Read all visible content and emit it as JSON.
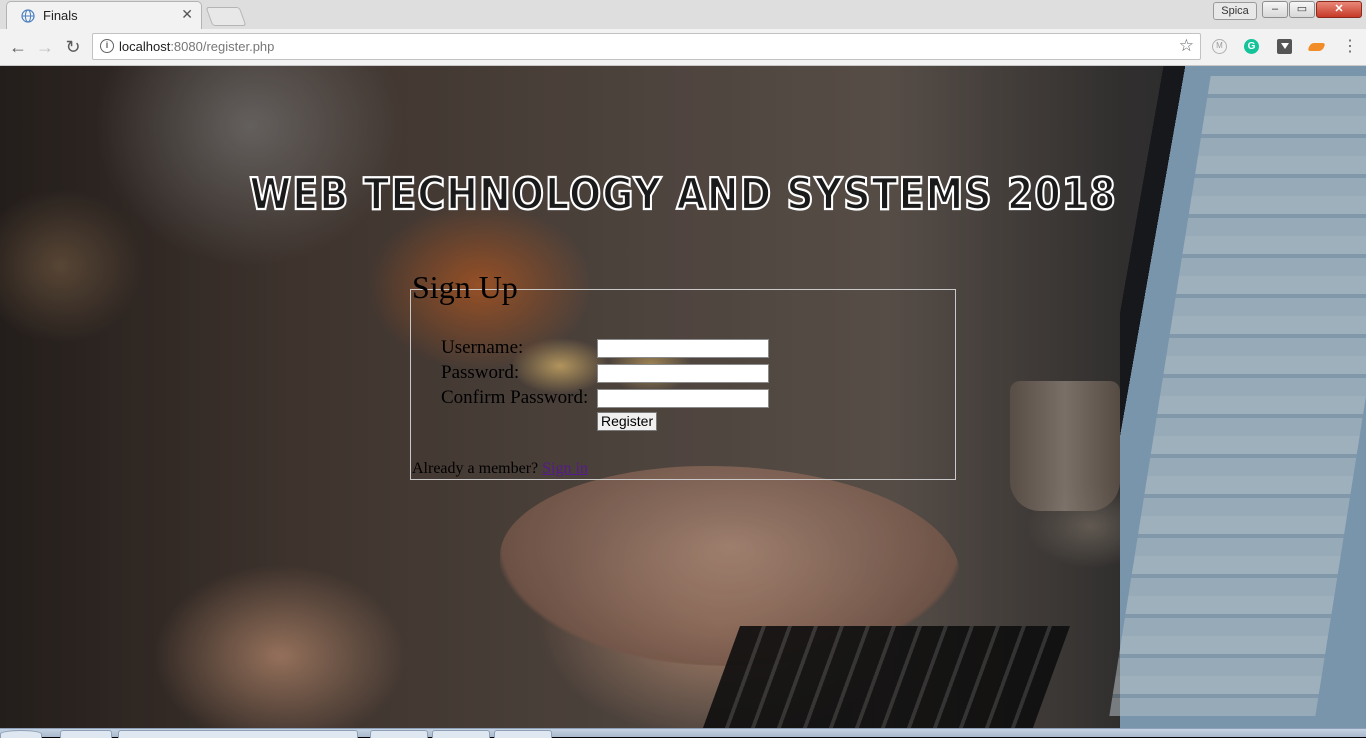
{
  "browser": {
    "tab_title": "Finals",
    "profile_name": "Spica",
    "url_host": "localhost",
    "url_path": ":8080/register.php",
    "window_controls": {
      "minimize": "–",
      "maximize": "▭",
      "close": "✕"
    },
    "icons": [
      "globe-icon",
      "back-arrow-icon",
      "forward-arrow-icon",
      "reload-icon",
      "info-icon",
      "star-icon",
      "grammarly-icon",
      "menu-icon"
    ]
  },
  "page": {
    "site_title": "WEB TECHNOLOGY AND SYSTEMS 2018",
    "signup": {
      "heading": "Sign Up",
      "username_label": "Username:",
      "password_label": "Password:",
      "confirm_label": "Confirm Password:",
      "username_value": "",
      "password_value": "",
      "confirm_value": "",
      "register_label": "Register",
      "member_prompt": "Already a member? ",
      "signin_link": "Sign in"
    }
  },
  "colors": {
    "link": "#551a8b",
    "close_button": "#c63a27",
    "grammarly": "#15c39a"
  }
}
